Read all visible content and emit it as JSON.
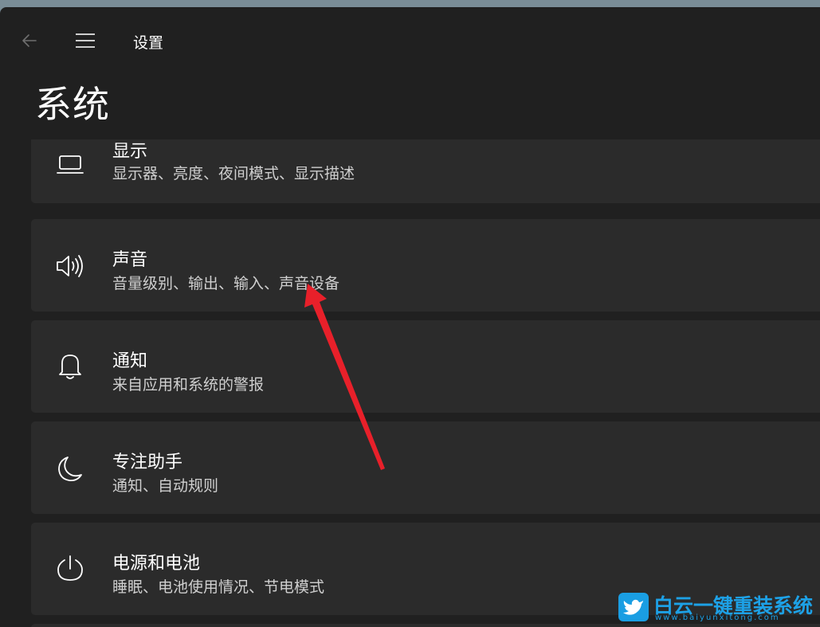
{
  "header": {
    "back_icon": "back-arrow-icon",
    "menu_icon": "hamburger-menu-icon",
    "app_title": "设置"
  },
  "page": {
    "title": "系统"
  },
  "items": [
    {
      "icon": "laptop-icon",
      "title": "显示",
      "subtitle": "显示器、亮度、夜间模式、显示描述"
    },
    {
      "icon": "speaker-icon",
      "title": "声音",
      "subtitle": "音量级别、输出、输入、声音设备"
    },
    {
      "icon": "bell-icon",
      "title": "通知",
      "subtitle": "来自应用和系统的警报"
    },
    {
      "icon": "moon-icon",
      "title": "专注助手",
      "subtitle": "通知、自动规则"
    },
    {
      "icon": "power-icon",
      "title": "电源和电池",
      "subtitle": "睡眠、电池使用情况、节电模式"
    }
  ],
  "annotation": {
    "arrow_color": "#e8202a"
  },
  "watermark": {
    "brand": "白云一键重装系统",
    "url": "www.baiyunxitong.com",
    "color": "#1da1e6"
  }
}
